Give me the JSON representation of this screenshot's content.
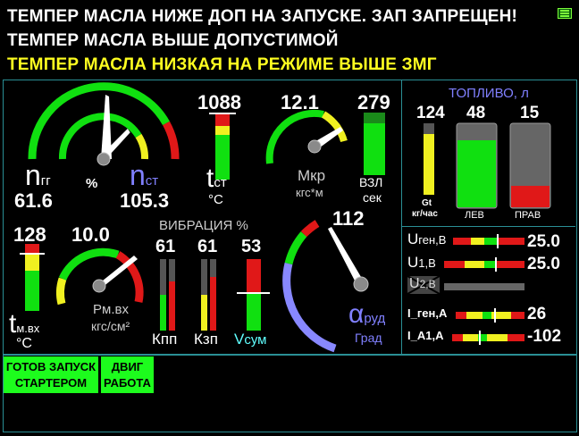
{
  "alarms": [
    {
      "text": "ТЕМПЕР МАСЛА НИЖЕ ДОП НА ЗАПУСКЕ. ЗАП ЗАПРЕЩЕН!",
      "color": "#ff2020"
    },
    {
      "text": "ТЕМПЕР МАСЛА ВЫШЕ ДОПУСТИМОЙ",
      "color": "#ff2020"
    },
    {
      "text": "ТЕМПЕР МАСЛА НИЗКАЯ НА РЕЖИМЕ ВЫШЕ ЗМГ",
      "color": "#ffff20"
    }
  ],
  "rotor": {
    "ngg_label": "n",
    "ngg_sub": "гг",
    "ngg_value": "61.6",
    "percent": "%",
    "nst_label": "n",
    "nst_sub": "ст",
    "nst_value": "105.3"
  },
  "tst": {
    "value": "1088",
    "label": "t",
    "sub": "ст",
    "unit": "°С"
  },
  "mkr": {
    "value": "12.1",
    "label": "Мкр",
    "unit": "кгс*м"
  },
  "vzl": {
    "value": "279",
    "label": "ВЗЛ",
    "unit": "сек"
  },
  "fuel": {
    "title": "ТОПЛИВО, л",
    "gt_value": "124",
    "gt_label": "Gt",
    "gt_unit": "кг/час",
    "left_value": "48",
    "left_label": "ЛЕВ",
    "right_value": "15",
    "right_label": "ПРАВ",
    "left_level": 0.8,
    "right_level": 0.28
  },
  "oil": {
    "t_value": "128",
    "t_label": "t",
    "t_sub": "м.вх",
    "t_unit": "°С",
    "p_value": "10.0",
    "p_label": "Рм.вх",
    "p_unit": "кгс/см²"
  },
  "vibration": {
    "title": "ВИБРАЦИЯ %",
    "kpp_value": "61",
    "kpp_label": "Кпп",
    "kzp_value": "61",
    "kzp_label": "Кзп",
    "vsum_value": "53",
    "vsum_label": "V",
    "vsum_sub": "сум"
  },
  "rudder": {
    "value": "112",
    "label": "α",
    "sub": "руд",
    "unit": "Град"
  },
  "electrics": {
    "ugen_label": "U",
    "ugen_sub": "ген,В",
    "ugen_value": "25.0",
    "u1_label": "U",
    "u1_sub": "1,В",
    "u1_value": "25.0",
    "u2_label": "U",
    "u2_sub": "2,В",
    "igen_label": "I_ген,А",
    "igen_value": "26",
    "ia1_label": "I_А1,А",
    "ia1_value": "-102"
  },
  "status": {
    "start_ready_line1": "ГОТОВ ЗАПУСК",
    "start_ready_line2": "СТАРТЕРОМ",
    "engine_line1": "ДВИГ",
    "engine_line2": "РАБОТА"
  },
  "colors": {
    "green": "#10e010",
    "yellow": "#f0f020",
    "red": "#e01818",
    "frame": "#2a8f95",
    "status": "#1dfc1d",
    "blue_text": "#8080ff",
    "cyan_text": "#60ffff"
  }
}
